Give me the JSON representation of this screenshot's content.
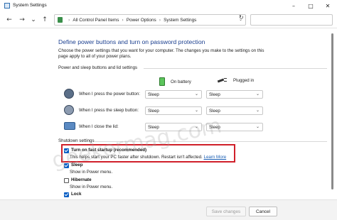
{
  "window": {
    "title": "System Settings"
  },
  "nav": {
    "breadcrumbs": [
      "All Control Panel Items",
      "Power Options",
      "System Settings"
    ]
  },
  "page": {
    "heading": "Define power buttons and turn on password protection",
    "intro": "Choose the power settings that you want for your computer. The changes you make to the settings on this page apply to all of your power plans."
  },
  "power_group": {
    "label": "Power and sleep buttons and lid settings",
    "columns": {
      "battery": "On battery",
      "plugged": "Plugged in"
    },
    "rows": [
      {
        "label": "When I press the power button:",
        "battery": "Sleep",
        "plugged": "Sleep"
      },
      {
        "label": "When I press the sleep button:",
        "battery": "Sleep",
        "plugged": "Sleep"
      },
      {
        "label": "When I close the lid:",
        "battery": "Sleep",
        "plugged": "Sleep"
      }
    ]
  },
  "shutdown": {
    "label": "Shutdown settings",
    "options": [
      {
        "title": "Turn on fast startup (recommended)",
        "desc": "This helps start your PC faster after shutdown. Restart isn't affected.",
        "link": "Learn More",
        "checked": true
      },
      {
        "title": "Sleep",
        "desc": "Show in Power menu.",
        "checked": true
      },
      {
        "title": "Hibernate",
        "desc": "Show in Power menu.",
        "checked": false
      },
      {
        "title": "Lock",
        "checked": true
      }
    ]
  },
  "footer": {
    "save": "Save changes",
    "cancel": "Cancel"
  },
  "watermark": "geekermag.com",
  "colors": {
    "accent": "#0a5fc4",
    "highlight": "#d0202a",
    "heading": "#1b3f8f"
  }
}
